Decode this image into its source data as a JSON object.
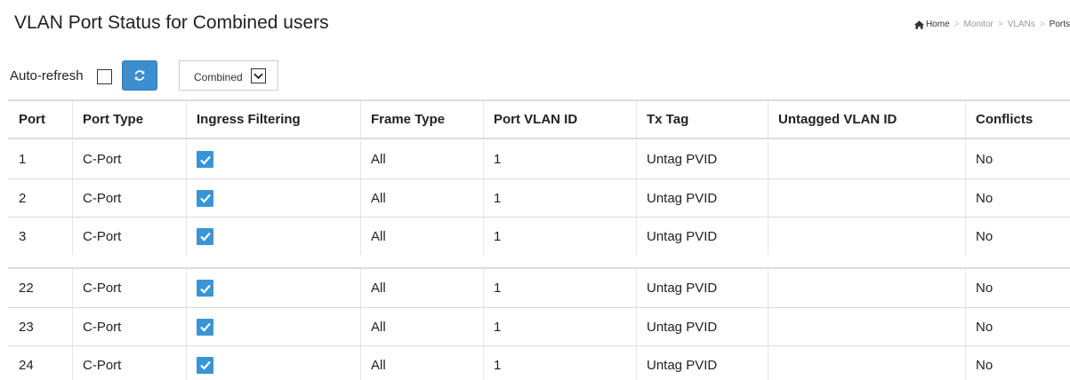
{
  "page": {
    "title": "VLAN Port Status for Combined users"
  },
  "breadcrumb": {
    "home": "Home",
    "items": [
      "Monitor",
      "VLANs",
      "Ports"
    ],
    "separator": ">"
  },
  "toolbar": {
    "auto_refresh_label": "Auto-refresh",
    "auto_refresh_checked": false,
    "user_select_value": "Combined"
  },
  "table": {
    "headers": [
      "Port",
      "Port Type",
      "Ingress Filtering",
      "Frame Type",
      "Port VLAN ID",
      "Tx Tag",
      "Untagged VLAN ID",
      "Conflicts"
    ],
    "rows": [
      {
        "port": "1",
        "port_type": "C-Port",
        "ingress_filtering": true,
        "frame_type": "All",
        "pvid": "1",
        "tx_tag": "Untag PVID",
        "untagged_vlan_id": "",
        "conflicts": "No"
      },
      {
        "port": "2",
        "port_type": "C-Port",
        "ingress_filtering": true,
        "frame_type": "All",
        "pvid": "1",
        "tx_tag": "Untag PVID",
        "untagged_vlan_id": "",
        "conflicts": "No"
      },
      {
        "port": "3",
        "port_type": "C-Port",
        "ingress_filtering": true,
        "frame_type": "All",
        "pvid": "1",
        "tx_tag": "Untag PVID",
        "untagged_vlan_id": "",
        "conflicts": "No"
      },
      {
        "port": "22",
        "port_type": "C-Port",
        "ingress_filtering": true,
        "frame_type": "All",
        "pvid": "1",
        "tx_tag": "Untag PVID",
        "untagged_vlan_id": "",
        "conflicts": "No"
      },
      {
        "port": "23",
        "port_type": "C-Port",
        "ingress_filtering": true,
        "frame_type": "All",
        "pvid": "1",
        "tx_tag": "Untag PVID",
        "untagged_vlan_id": "",
        "conflicts": "No"
      },
      {
        "port": "24",
        "port_type": "C-Port",
        "ingress_filtering": true,
        "frame_type": "All",
        "pvid": "1",
        "tx_tag": "Untag PVID",
        "untagged_vlan_id": "",
        "conflicts": "No"
      }
    ]
  },
  "colors": {
    "accent": "#3b8fd0",
    "checkbox": "#3a95d4",
    "border": "#dddddd"
  },
  "icons": {
    "home": "home-icon",
    "refresh": "refresh-icon",
    "check": "check-icon",
    "dropdown": "chevron-down-icon"
  }
}
